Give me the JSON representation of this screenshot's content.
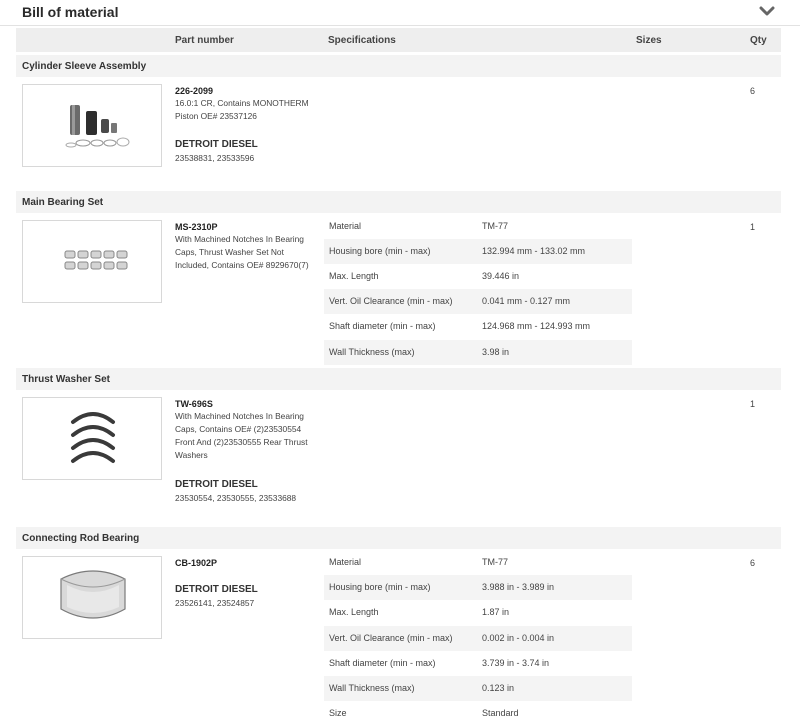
{
  "header": {
    "title": "Bill of material",
    "collapse_icon": "chevron-down-icon"
  },
  "columns": {
    "part_number": "Part number",
    "specifications": "Specifications",
    "sizes": "Sizes",
    "qty": "Qty"
  },
  "sections": [
    {
      "title": "Cylinder Sleeve Assembly",
      "part_number": "226-2099",
      "description": [
        "16.0:1 CR, Contains MONOTHERM",
        "Piston OE# 23537126"
      ],
      "brand": "DETROIT DIESEL",
      "oe_numbers": "23538831, 23533596",
      "qty": "6",
      "specs": []
    },
    {
      "title": "Main Bearing Set",
      "part_number": "MS-2310P",
      "description": [
        "With Machined Notches In Bearing",
        "Caps, Thrust Washer Set Not",
        "Included, Contains OE# 8929670(7)"
      ],
      "brand": "",
      "oe_numbers": "",
      "qty": "1",
      "specs": [
        {
          "label": "Material",
          "value": "TM-77"
        },
        {
          "label": "Housing bore (min - max)",
          "value": "132.994 mm - 133.02 mm"
        },
        {
          "label": "Max. Length",
          "value": "39.446 in"
        },
        {
          "label": "Vert. Oil Clearance (min - max)",
          "value": "0.041 mm - 0.127 mm"
        },
        {
          "label": "Shaft diameter (min - max)",
          "value": "124.968 mm - 124.993 mm"
        },
        {
          "label": "Wall Thickness (max)",
          "value": "3.98 in"
        }
      ]
    },
    {
      "title": "Thrust Washer Set",
      "part_number": "TW-696S",
      "description": [
        "With Machined Notches In Bearing",
        "Caps, Contains OE# (2)23530554",
        "Front And (2)23530555 Rear Thrust",
        "Washers"
      ],
      "brand": "DETROIT DIESEL",
      "oe_numbers": "23530554, 23530555, 23533688",
      "qty": "1",
      "specs": []
    },
    {
      "title": "Connecting Rod Bearing",
      "part_number": "CB-1902P",
      "description": [],
      "brand": "DETROIT DIESEL",
      "oe_numbers": "23526141, 23524857",
      "qty": "6",
      "specs": [
        {
          "label": "Material",
          "value": "TM-77"
        },
        {
          "label": "Housing bore (min - max)",
          "value": "3.988 in - 3.989 in"
        },
        {
          "label": "Max. Length",
          "value": "1.87 in"
        },
        {
          "label": "Vert. Oil Clearance (min - max)",
          "value": "0.002 in - 0.004 in"
        },
        {
          "label": "Shaft diameter (min - max)",
          "value": "3.739 in - 3.74 in"
        },
        {
          "label": "Wall Thickness (max)",
          "value": "0.123 in"
        },
        {
          "label": "Size",
          "value": "Standard"
        }
      ]
    }
  ]
}
